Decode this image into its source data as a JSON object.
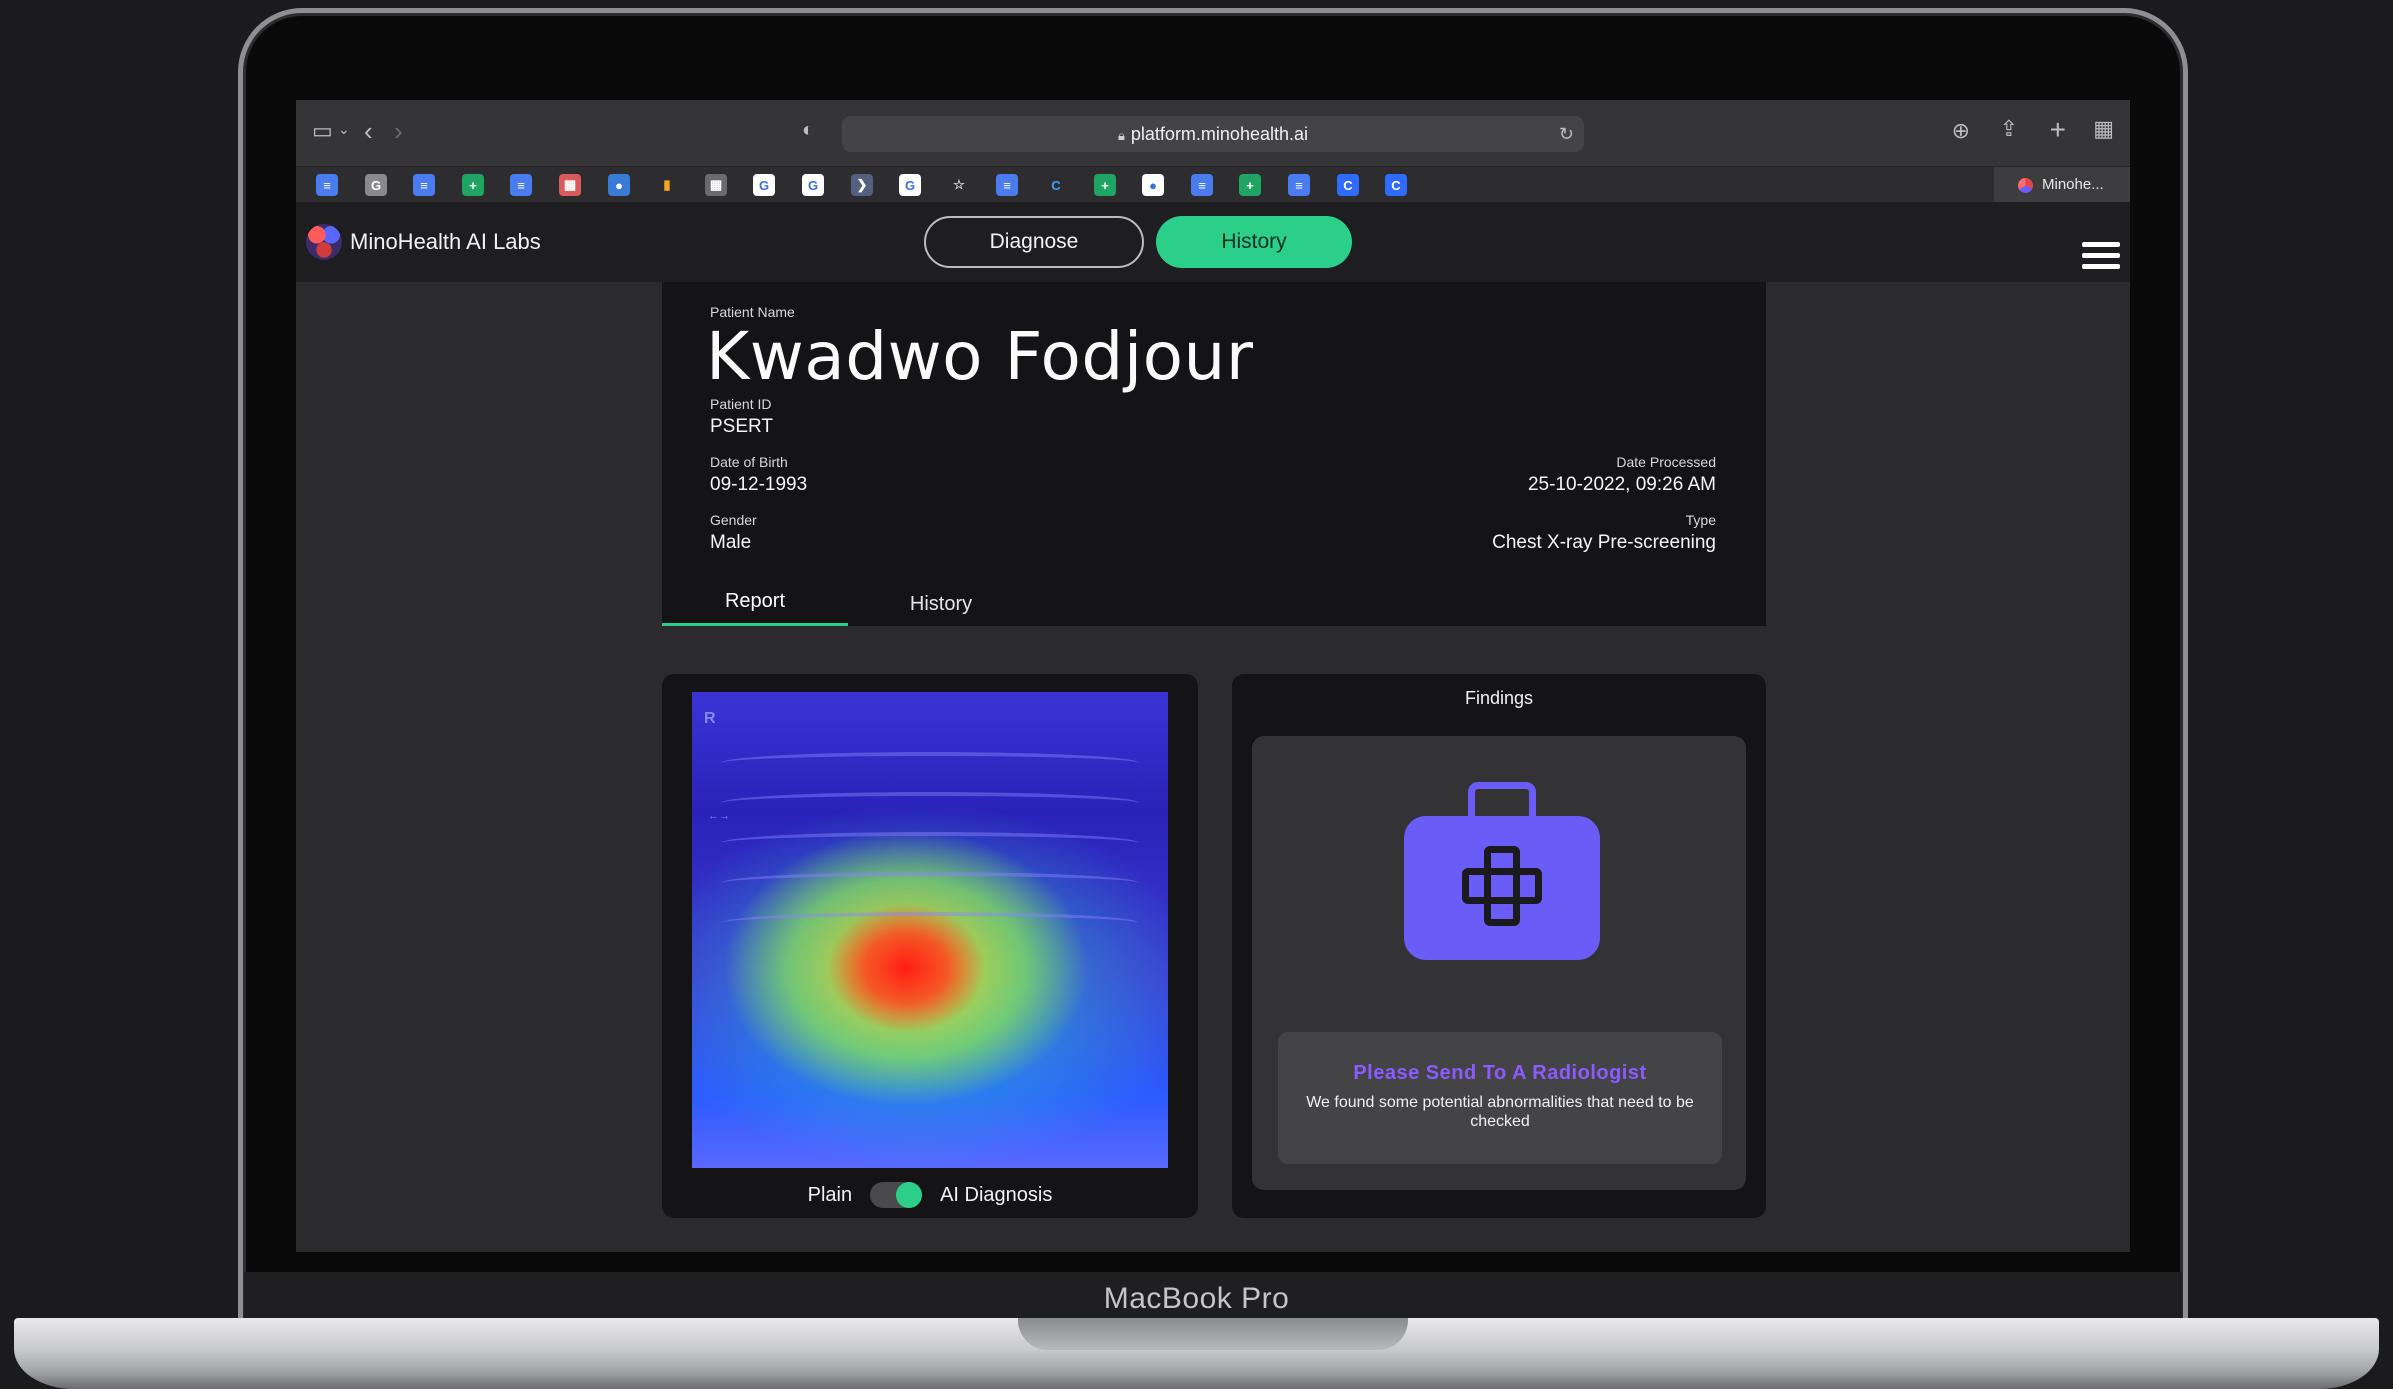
{
  "device": {
    "label": "MacBook Pro"
  },
  "browser": {
    "url": "platform.minohealth.ai",
    "active_tab": "Minohe..."
  },
  "bookmarks": [
    {
      "icon": "docs-icon",
      "color": "#4a7cf0",
      "glyph": "≡"
    },
    {
      "icon": "g-icon",
      "color": "#8a8a8e",
      "glyph": "G"
    },
    {
      "icon": "docs-icon",
      "color": "#4a7cf0",
      "glyph": "≡"
    },
    {
      "icon": "sheets-icon",
      "color": "#1fa463",
      "glyph": "+"
    },
    {
      "icon": "docs-icon",
      "color": "#4a7cf0",
      "glyph": "≡"
    },
    {
      "icon": "calendar-icon",
      "color": "#d85a5a",
      "glyph": "▦"
    },
    {
      "icon": "chat-icon",
      "color": "#3a7bd5",
      "glyph": "●"
    },
    {
      "icon": "analytics-icon",
      "color": "#2d2d30",
      "glyph": "▮"
    },
    {
      "icon": "app-icon",
      "color": "#6b6b6e",
      "glyph": "▦"
    },
    {
      "icon": "google-icon",
      "color": "#ffffff",
      "glyph": "G"
    },
    {
      "icon": "google-icon",
      "color": "#ffffff",
      "glyph": "G"
    },
    {
      "icon": "app-icon",
      "color": "#556080",
      "glyph": "❯"
    },
    {
      "icon": "google-icon",
      "color": "#ffffff",
      "glyph": "G"
    },
    {
      "icon": "star-icon",
      "color": "#2d2d30",
      "glyph": "☆"
    },
    {
      "icon": "docs-icon",
      "color": "#4a7cf0",
      "glyph": "≡"
    },
    {
      "icon": "c-icon",
      "color": "#2d2d30",
      "glyph": "C"
    },
    {
      "icon": "sheets-icon",
      "color": "#1fa463",
      "glyph": "+"
    },
    {
      "icon": "github-icon",
      "color": "#ffffff",
      "glyph": "●"
    },
    {
      "icon": "docs-icon",
      "color": "#4a7cf0",
      "glyph": "≡"
    },
    {
      "icon": "sheets-icon",
      "color": "#1fa463",
      "glyph": "+"
    },
    {
      "icon": "docs-icon",
      "color": "#4a7cf0",
      "glyph": "≡"
    },
    {
      "icon": "c-icon",
      "color": "#2f6bff",
      "glyph": "C"
    },
    {
      "icon": "c-icon",
      "color": "#2f6bff",
      "glyph": "C"
    }
  ],
  "app": {
    "brand": "MinoHealth AI Labs",
    "nav": {
      "diagnose": "Diagnose",
      "history": "History"
    },
    "accent": "#2ccf8a"
  },
  "patient": {
    "name_label": "Patient Name",
    "name": "Kwadwo Fodjour",
    "id_label": "Patient ID",
    "id": "PSERT",
    "dob_label": "Date of Birth",
    "dob": "09-12-1993",
    "gender_label": "Gender",
    "gender": "Male",
    "processed_label": "Date Processed",
    "processed": "25-10-2022, 09:26 AM",
    "type_label": "Type",
    "type": "Chest X-ray Pre-screening"
  },
  "tabs": {
    "report": "Report",
    "history": "History"
  },
  "image_view": {
    "plain_label": "Plain",
    "ai_label": "AI Diagnosis",
    "ai_enabled": true,
    "xray_marker": "R"
  },
  "findings": {
    "title": "Findings",
    "icon": "first-aid-kit-icon",
    "alert_title": "Please Send To A Radiologist",
    "alert_text": "We found some potential abnormalities that need to be checked",
    "alert_color": "#8a5cff"
  }
}
